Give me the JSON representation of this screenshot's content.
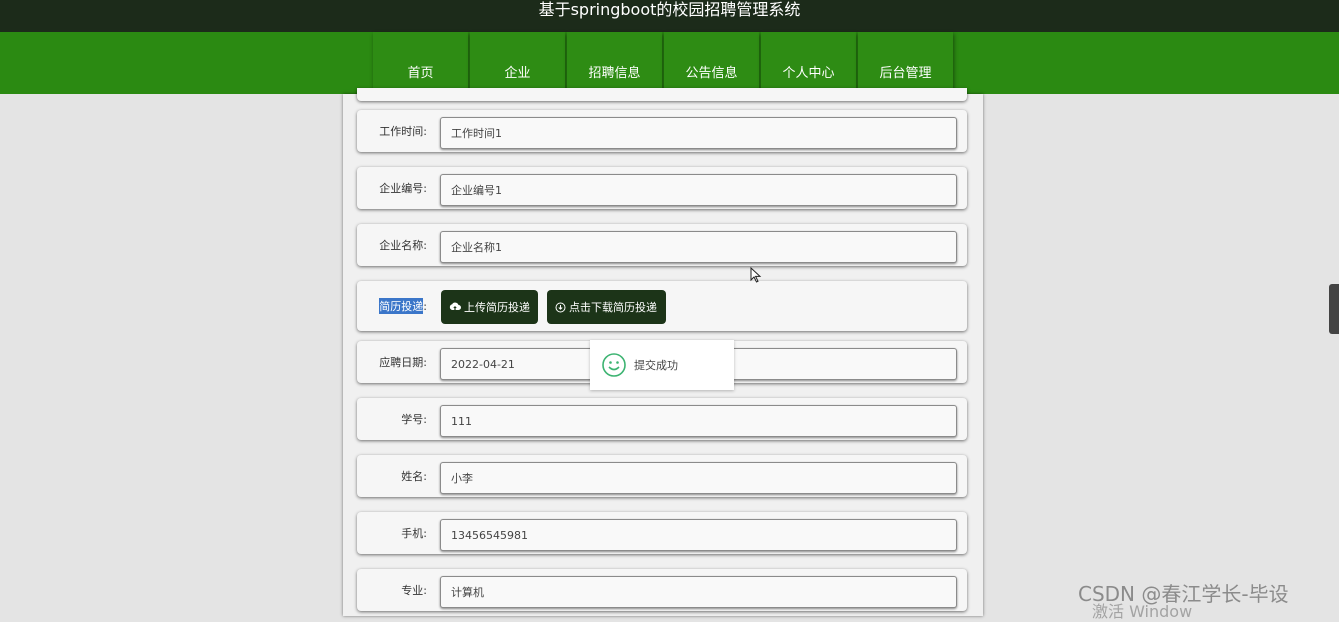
{
  "header": {
    "title": "基于springboot的校园招聘管理系统"
  },
  "nav": {
    "items": [
      {
        "label": "首页"
      },
      {
        "label": "企业"
      },
      {
        "label": "招聘信息"
      },
      {
        "label": "公告信息"
      },
      {
        "label": "个人中心"
      },
      {
        "label": "后台管理"
      }
    ]
  },
  "form": {
    "work_time": {
      "label": "工作时间:",
      "value": "工作时间1"
    },
    "company_no": {
      "label": "企业编号:",
      "value": "企业编号1"
    },
    "company_name": {
      "label": "企业名称:",
      "value": "企业名称1"
    },
    "resume": {
      "label": "简历投递",
      "colon": ":",
      "upload_label": "上传简历投递",
      "download_label": "点击下载简历投递"
    },
    "apply_date": {
      "label": "应聘日期:",
      "value": "2022-04-21"
    },
    "student_no": {
      "label": "学号:",
      "value": "111"
    },
    "name": {
      "label": "姓名:",
      "value": "小李"
    },
    "phone": {
      "label": "手机:",
      "value": "13456545981"
    },
    "major": {
      "label": "专业:",
      "value": "计算机"
    }
  },
  "toast": {
    "message": "提交成功",
    "icon": "smile-icon"
  },
  "watermark": {
    "text": "CSDN @春江学长-毕设",
    "activate": "激活 Window"
  },
  "colors": {
    "nav_green": "#2b8a12",
    "title_dark": "#1c2b1a",
    "button_dark": "#1c3418",
    "toast_icon": "#3cb371"
  }
}
